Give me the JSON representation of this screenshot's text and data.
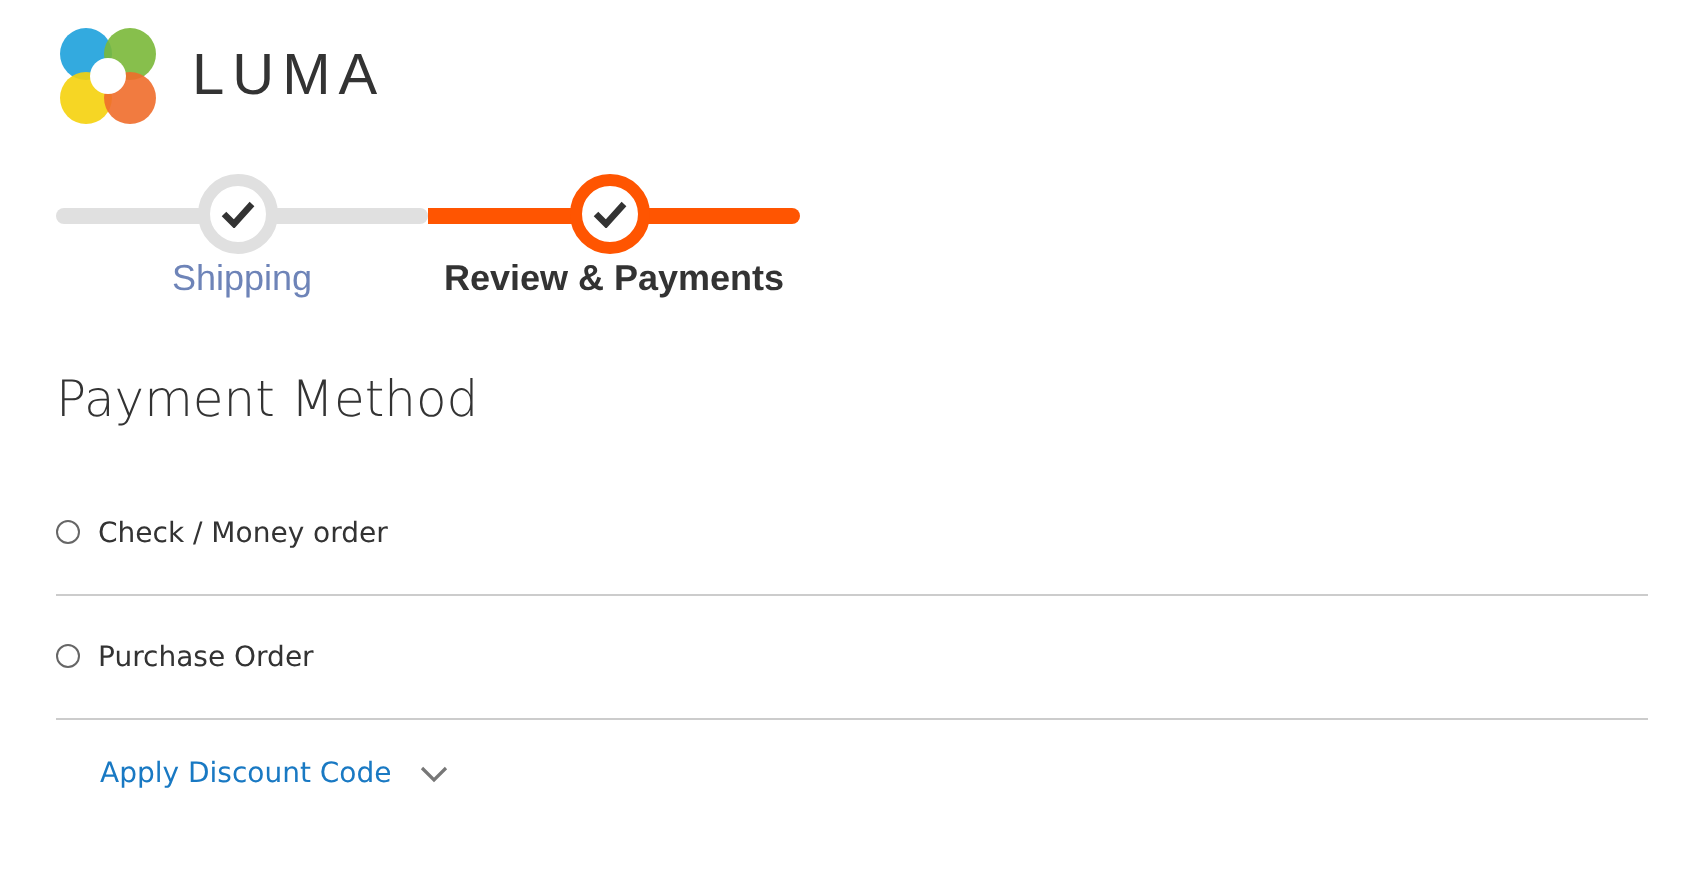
{
  "logo": {
    "text": "LUMA"
  },
  "steps": [
    {
      "label": "Shipping",
      "selected": false
    },
    {
      "label": "Review & Payments",
      "selected": true
    }
  ],
  "payment": {
    "title": "Payment Method",
    "methods": [
      {
        "label": "Check / Money order",
        "selected": false
      },
      {
        "label": "Purchase Order",
        "selected": false
      }
    ]
  },
  "discount": {
    "label": "Apply Discount Code",
    "expanded": false
  }
}
